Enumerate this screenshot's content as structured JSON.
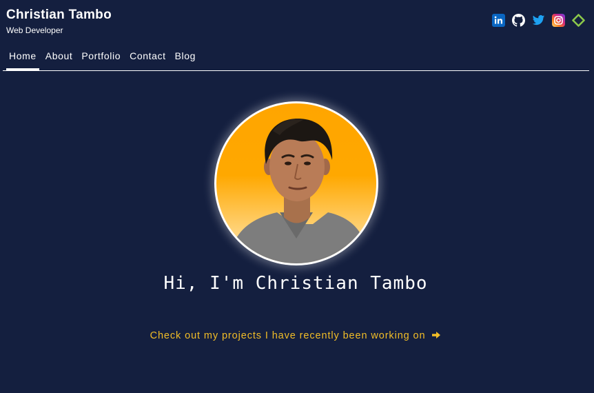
{
  "brand": {
    "name": "Christian Tambo",
    "subtitle": "Web Developer"
  },
  "socials": [
    {
      "icon": "linkedin-icon",
      "color": "#0a66c2"
    },
    {
      "icon": "github-icon",
      "color": "#ffffff"
    },
    {
      "icon": "twitter-icon",
      "color": "#1da1f2"
    },
    {
      "icon": "instagram-icon",
      "color": "#d62976"
    },
    {
      "icon": "codepen-icon",
      "color": "#8cc84b"
    }
  ],
  "nav": {
    "items": [
      {
        "label": "Home",
        "active": true
      },
      {
        "label": "About",
        "active": false
      },
      {
        "label": "Portfolio",
        "active": false
      },
      {
        "label": "Contact",
        "active": false
      },
      {
        "label": "Blog",
        "active": false
      }
    ]
  },
  "hero": {
    "title": "Hi, I'm Christian Tambo",
    "cta": "Check out my projects I have recently been working on",
    "cta_icon": "arrow-right-icon"
  },
  "colors": {
    "background": "#141f3f",
    "accent": "#f2bd27",
    "avatar_bg": "#ffa500"
  }
}
